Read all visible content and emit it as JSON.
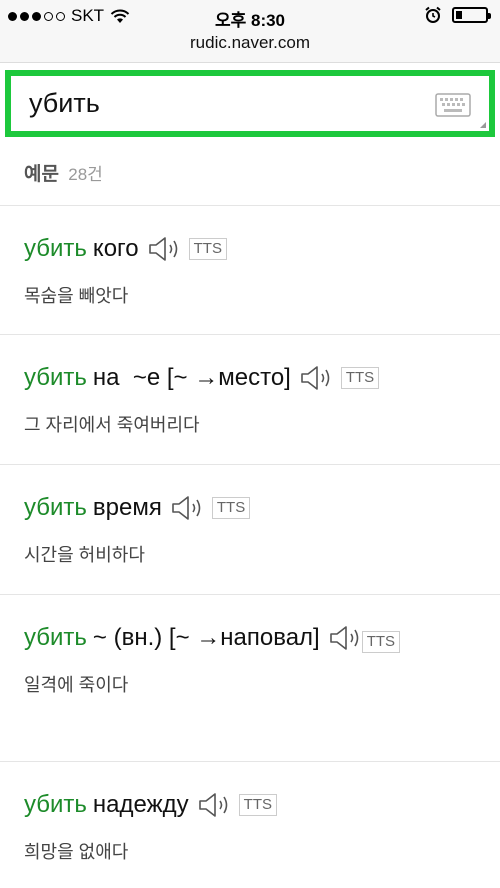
{
  "status": {
    "carrier": "SKT",
    "time": "오후 8:30"
  },
  "browser": {
    "url": "rudic.naver.com"
  },
  "search": {
    "value": "убить"
  },
  "section": {
    "title": "예문",
    "count": "28건"
  },
  "tts_label": "TTS",
  "examples": [
    {
      "keyword": "убить",
      "rest": "кого",
      "meaning": "목숨을 빼앗다"
    },
    {
      "keyword": "убить",
      "rest": "на  ~е [~ →место]",
      "meaning": "그 자리에서 죽여버리다"
    },
    {
      "keyword": "убить",
      "rest": "время",
      "meaning": "시간을 허비하다"
    },
    {
      "keyword": "убить",
      "rest": "~ (вн.) [~ →наповал]",
      "meaning": "일격에 죽이다"
    },
    {
      "keyword": "убить",
      "rest": "надежду",
      "meaning": "희망을 없애다"
    }
  ],
  "colors": {
    "accent_green": "#1dc83c",
    "keyword_green": "#1d8b2a"
  }
}
